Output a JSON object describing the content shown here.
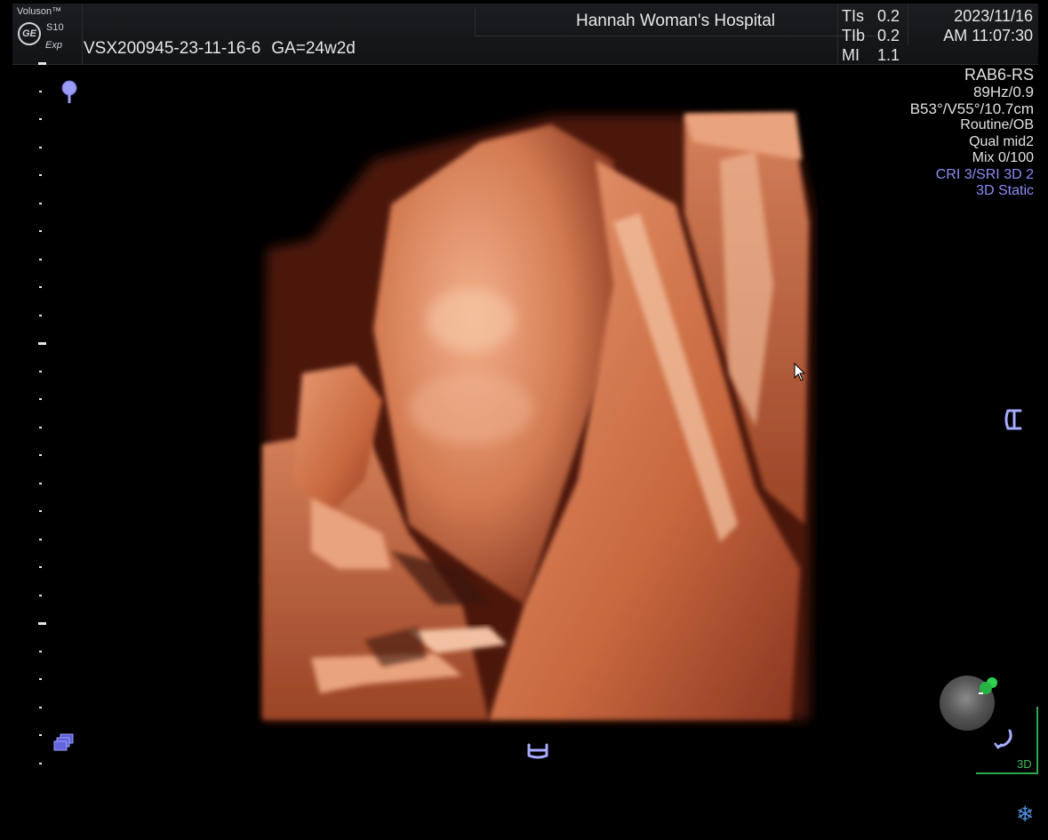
{
  "header": {
    "brand": "Voluson™",
    "logo_text": "GE",
    "model": "S10",
    "mode_tag": "Exp",
    "hospital": "Hannah Woman's Hospital",
    "patient_id": "VSX200945-23-11-16-6",
    "gestational_age": "GA=24w2d",
    "indices": [
      {
        "label": "TIs",
        "value": "0.2"
      },
      {
        "label": "TIb",
        "value": "0.2"
      },
      {
        "label": "MI",
        "value": "1.1"
      }
    ],
    "date": "2023/11/16",
    "time": "AM 11:07:30"
  },
  "info": {
    "probe": "RAB6-RS",
    "frame_rate": "89Hz/0.9",
    "geometry": "B53°/V55°/10.7cm",
    "preset": "Routine/OB",
    "quality": "Qual mid2",
    "mix": "Mix 0/100",
    "cri": "CRI 3/SRI 3D 2",
    "mode": "3D Static"
  },
  "orientation": {
    "label": "3D"
  },
  "icons": {
    "marker": "focus-marker-icon",
    "layers": "layers-icon",
    "calipers_bottom": "bracket-icon",
    "calipers_right": "bracket-icon",
    "cursor": "mouse-pointer-icon",
    "sphere": "orientation-sphere-icon",
    "rotate": "rotate-icon",
    "freeze": "snowflake-icon"
  },
  "colors": {
    "accent_blue": "#8b8cf6",
    "accent_green": "#2ea84a",
    "render_skin": "#d9805a"
  }
}
